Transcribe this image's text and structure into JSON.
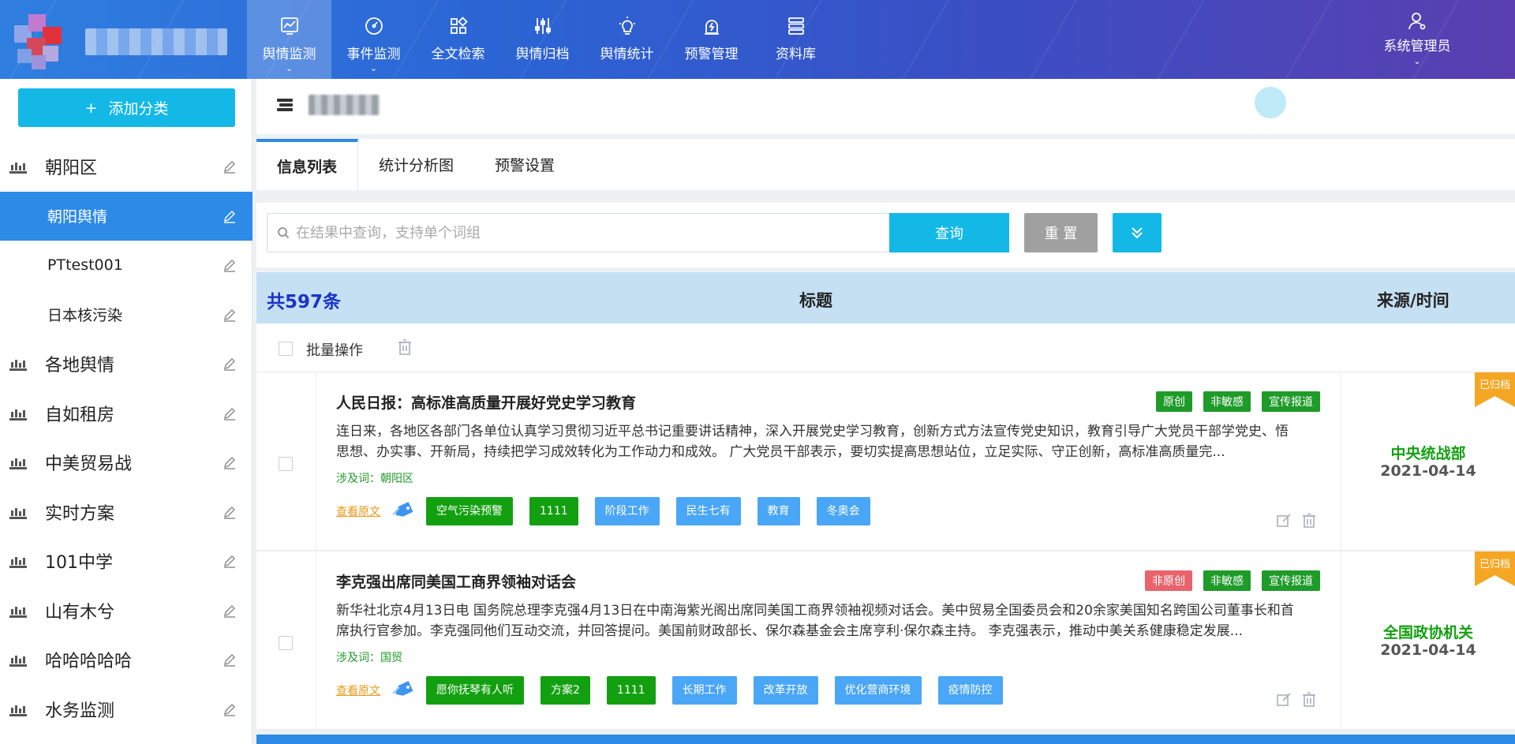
{
  "nav": {
    "items": [
      {
        "label": "舆情监测",
        "icon": "chart-icon",
        "active": true,
        "caret": true
      },
      {
        "label": "事件监测",
        "icon": "gauge-icon",
        "active": false,
        "caret": true
      },
      {
        "label": "全文检索",
        "icon": "grid-icon",
        "active": false,
        "caret": false
      },
      {
        "label": "舆情归档",
        "icon": "sliders-icon",
        "active": false,
        "caret": false
      },
      {
        "label": "舆情统计",
        "icon": "bulb-icon",
        "active": false,
        "caret": false
      },
      {
        "label": "预警管理",
        "icon": "alarm-icon",
        "active": false,
        "caret": false
      },
      {
        "label": "资料库",
        "icon": "database-icon",
        "active": false,
        "caret": false
      }
    ],
    "user": "系统管理员",
    "caret": "⌄"
  },
  "sidebar": {
    "add_label": "添加分类",
    "add_plus": "+",
    "items": [
      {
        "label": "朝阳区",
        "sub": false,
        "selected": false
      },
      {
        "label": "朝阳舆情",
        "sub": true,
        "selected": true
      },
      {
        "label": "PTtest001",
        "sub": true,
        "selected": false
      },
      {
        "label": "日本核污染",
        "sub": true,
        "selected": false
      },
      {
        "label": "各地舆情",
        "sub": false,
        "selected": false
      },
      {
        "label": "自如租房",
        "sub": false,
        "selected": false
      },
      {
        "label": "中美贸易战",
        "sub": false,
        "selected": false
      },
      {
        "label": "实时方案",
        "sub": false,
        "selected": false
      },
      {
        "label": "101中学",
        "sub": false,
        "selected": false
      },
      {
        "label": "山有木兮",
        "sub": false,
        "selected": false
      },
      {
        "label": "哈哈哈哈哈",
        "sub": false,
        "selected": false
      },
      {
        "label": "水务监测",
        "sub": false,
        "selected": false
      }
    ]
  },
  "tabs": [
    "信息列表",
    "统计分析图",
    "预警设置"
  ],
  "search": {
    "placeholder": "在结果中查询，支持单个词组",
    "value": "",
    "query_label": "查询",
    "reset_label": "重 置"
  },
  "list": {
    "total": "共597条",
    "col_title": "标题",
    "col_source": "来源/时间",
    "batch_label": "批量操作",
    "view_original": "查看原文",
    "archived_label": "已归档",
    "items": [
      {
        "title": "人民日报：高标准高质量开展好党史学习教育",
        "badges": [
          {
            "text": "原创",
            "color": "green"
          },
          {
            "text": "非敏感",
            "color": "green"
          },
          {
            "text": "宣传报道",
            "color": "green"
          }
        ],
        "summary": "连日来，各地区各部门各单位认真学习贯彻习近平总书记重要讲话精神，深入开展党史学习教育，创新方式方法宣传党史知识，教育引导广大党员干部学党史、悟思想、办实事、开新局，持续把学习成效转化为工作动力和成效。 广大党员干部表示，要切实提高思想站位，立足实际、守正创新，高标准高质量完...",
        "keywords": "涉及词：朝阳区",
        "tags": [
          {
            "text": "空气污染预警",
            "color": "green"
          },
          {
            "text": "1111",
            "color": "green"
          },
          {
            "text": "阶段工作",
            "color": "blue"
          },
          {
            "text": "民生七有",
            "color": "blue"
          },
          {
            "text": "教育",
            "color": "blue"
          },
          {
            "text": "冬奥会",
            "color": "blue"
          }
        ],
        "source": "中央统战部",
        "date": "2021-04-14"
      },
      {
        "title": "李克强出席同美国工商界领袖对话会",
        "badges": [
          {
            "text": "非原创",
            "color": "red"
          },
          {
            "text": "非敏感",
            "color": "green"
          },
          {
            "text": "宣传报道",
            "color": "green"
          }
        ],
        "summary": "新华社北京4月13日电 国务院总理李克强4月13日在中南海紫光阁出席同美国工商界领袖视频对话会。美中贸易全国委员会和20余家美国知名跨国公司董事长和首席执行官参加。李克强同他们互动交流，并回答提问。美国前财政部长、保尔森基金会主席亨利·保尔森主持。 李克强表示，推动中美关系健康稳定发展...",
        "keywords": "涉及词：国贸",
        "tags": [
          {
            "text": "愿你抚琴有人听",
            "color": "green"
          },
          {
            "text": "方案2",
            "color": "green"
          },
          {
            "text": "1111",
            "color": "green"
          },
          {
            "text": "长期工作",
            "color": "blue"
          },
          {
            "text": "改革开放",
            "color": "blue"
          },
          {
            "text": "优化营商环境",
            "color": "blue"
          },
          {
            "text": "疫情防控",
            "color": "blue"
          }
        ],
        "source": "全国政协机关",
        "date": "2021-04-14"
      }
    ]
  },
  "colors": {
    "accent": "#14b8e6",
    "selected": "#2d8ae6",
    "green": "#13a010",
    "blue": "#4aa6f6",
    "red": "#e8636b",
    "orange": "#f5a623"
  }
}
